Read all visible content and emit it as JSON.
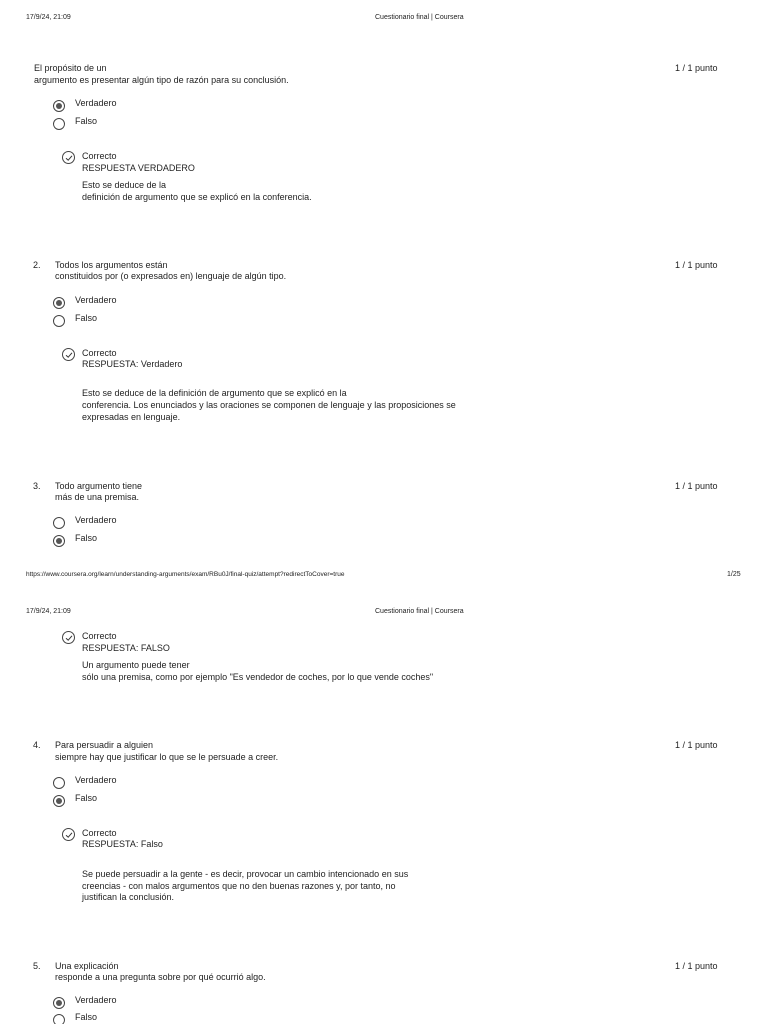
{
  "page1": {
    "datetime": "17/9/24, 21:09",
    "doc_title": "Cuestionario final | Coursera"
  },
  "footer": {
    "url": "https://www.coursera.org/learn/understanding-arguments/exam/RBu0J/final-quiz/attempt?redirectToCover=true",
    "page": "1/25"
  },
  "page2": {
    "datetime": "17/9/24, 21:09",
    "doc_title": "Cuestionario final | Coursera"
  },
  "option_labels": {
    "true": "Verdadero",
    "false": "Falso"
  },
  "q1": {
    "lines": [
      "El propósito de un",
      "argumento es presentar algún tipo de razón para su conclusión."
    ],
    "score": "1 / 1 punto",
    "feedback": {
      "status": "Correcto",
      "answer": "RESPUESTA VERDADERO",
      "explanation": [
        "Esto se deduce de la",
        "definición de argumento que se explicó en la conferencia."
      ]
    }
  },
  "q2": {
    "number": "2.",
    "lines": [
      "Todos los argumentos están",
      "constituidos por (o expresados en) lenguaje de algún tipo."
    ],
    "score": "1 / 1 punto",
    "feedback": {
      "status": "Correcto",
      "answer": "RESPUESTA: Verdadero",
      "explanation": [
        "Esto se deduce de la definición de argumento que se explicó en la",
        "conferencia. Los enunciados y las oraciones se componen de lenguaje y las proposiciones se",
        "expresadas en lenguaje."
      ]
    }
  },
  "q3": {
    "number": "3.",
    "lines": [
      "Todo argumento tiene",
      "más de una premisa."
    ],
    "score": "1 / 1 punto",
    "feedback": {
      "status": "Correcto",
      "answer": "RESPUESTA: FALSO",
      "explanation": [
        "Un argumento puede tener",
        "sólo una premisa, como por ejemplo \"Es vendedor de coches, por lo que vende coches\""
      ]
    }
  },
  "q4": {
    "number": "4.",
    "lines": [
      "Para persuadir a alguien",
      "siempre hay que justificar lo que se le persuade a creer."
    ],
    "score": "1 / 1 punto",
    "feedback": {
      "status": "Correcto",
      "answer": "RESPUESTA: Falso",
      "explanation": [
        "Se puede persuadir a la gente - es decir, provocar un cambio intencionado en sus",
        "creencias - con malos argumentos que no den buenas razones y, por tanto, no",
        "justifican la conclusión."
      ]
    }
  },
  "q5": {
    "number": "5.",
    "lines": [
      "Una explicación",
      "responde a una pregunta sobre por qué ocurrió algo."
    ],
    "score": "1 / 1 punto"
  }
}
